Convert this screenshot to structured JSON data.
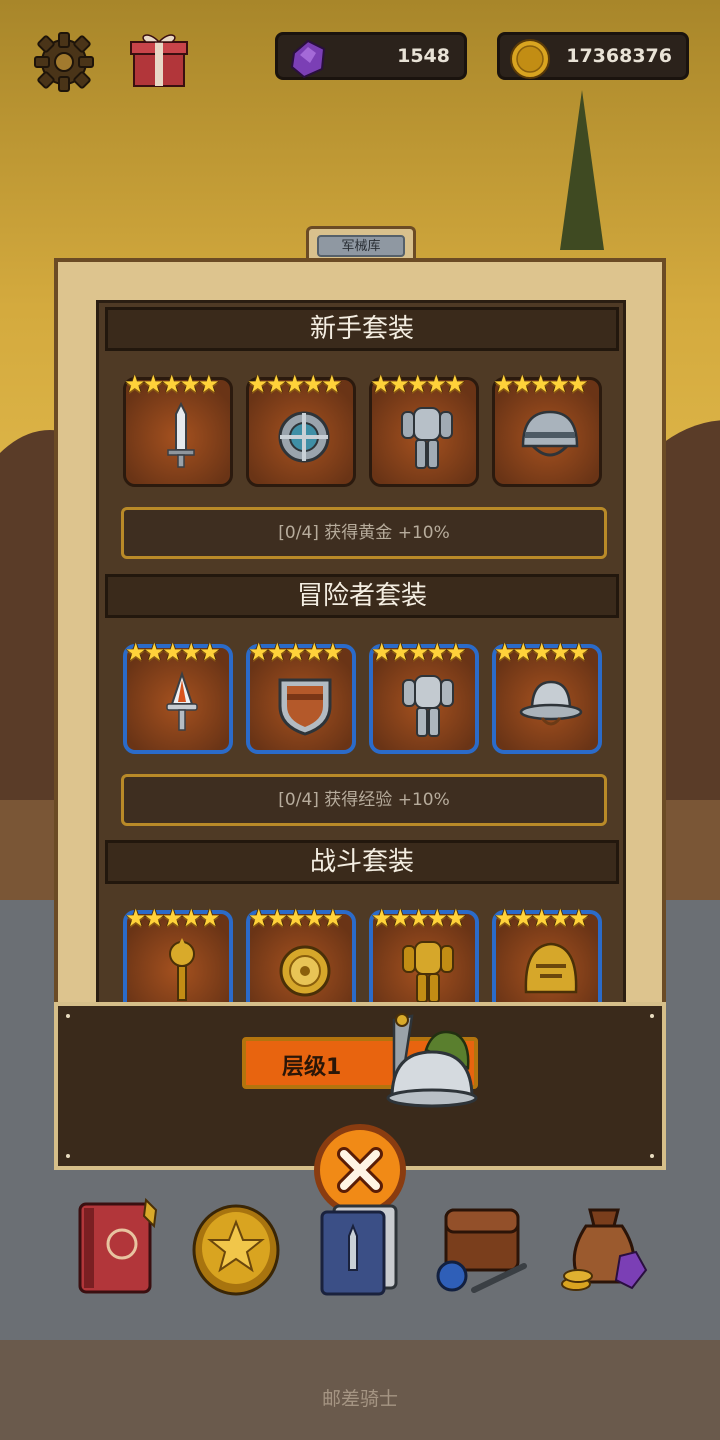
{
  "resources": {
    "gems": "1548",
    "gold": "17368376"
  },
  "armory_tab": "军械库",
  "sets": [
    {
      "name": "新手套装",
      "frame": "brown",
      "items": [
        "sword-icon",
        "round-shield-icon",
        "armor-icon",
        "helmet-icon"
      ],
      "bonus": "[0/4] 获得黄金 +10%"
    },
    {
      "name": "冒险者套装",
      "frame": "blue",
      "items": [
        "dagger-icon",
        "kite-shield-icon",
        "armor-icon",
        "kettle-helmet-icon"
      ],
      "bonus": "[0/4] 获得经验 +10%"
    },
    {
      "name": "战斗套装",
      "frame": "blue",
      "items": [
        "mace-icon",
        "gold-shield-icon",
        "gold-armor-icon",
        "gold-helmet-icon"
      ]
    }
  ],
  "stars": "★★★★★",
  "level_label": "层级1",
  "footer_text": "邮差骑士",
  "colors": {
    "accent_orange": "#e8640f",
    "star": "#ffd23a",
    "blue_frame": "#2b6bc9"
  }
}
